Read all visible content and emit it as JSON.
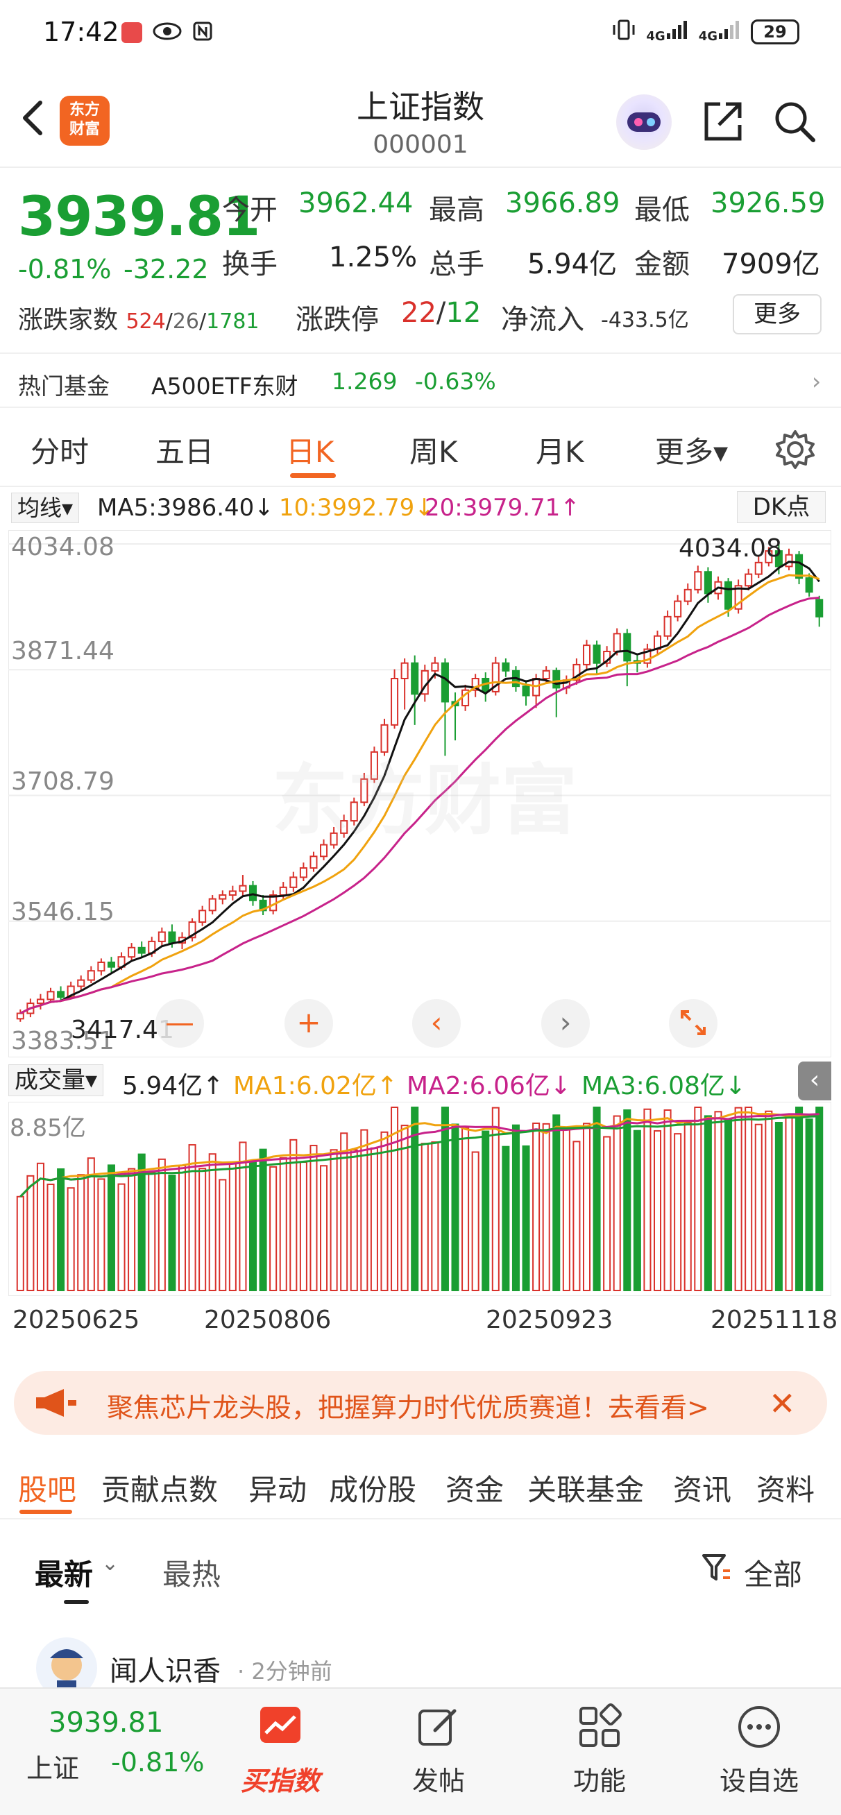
{
  "status": {
    "time": "17:42",
    "battery": "29",
    "net1": "4G",
    "net2": "4G"
  },
  "header": {
    "title": "上证指数",
    "code": "000001",
    "logo_line1": "东方",
    "logo_line2": "财富"
  },
  "quote": {
    "price": "3939.81",
    "pct": "-0.81%",
    "change": "-32.22",
    "open_label": "今开",
    "open": "3962.44",
    "high_label": "最高",
    "high": "3966.89",
    "low_label": "最低",
    "low": "3926.59",
    "turnover_label": "换手",
    "turnover": "1.25%",
    "volume_label": "总手",
    "volume": "5.94亿",
    "amount_label": "金额",
    "amount": "7909亿",
    "breadth_label": "涨跌家数",
    "breadth_up": "524",
    "breadth_flat": "26",
    "breadth_down": "1781",
    "limit_label": "涨跌停",
    "limit_up": "22",
    "limit_down": "12",
    "inflow_label": "净流入",
    "inflow": "-433.5亿",
    "more": "更多"
  },
  "hotfund": {
    "label": "热门基金",
    "name": "A500ETF东财",
    "price": "1.269",
    "pct": "-0.63%"
  },
  "tabs": [
    "分时",
    "五日",
    "日K",
    "周K",
    "月K",
    "更多▾"
  ],
  "ma": {
    "selector": "均线▾",
    "ma5": "MA5:3986.40↓",
    "ma10": "10:3992.79↓",
    "ma20": "20:3979.71↑",
    "dk": "DK点"
  },
  "kchart": {
    "y_labels": [
      "4034.08",
      "3871.44",
      "3708.79",
      "3546.15",
      "3383.51"
    ],
    "high_mark": "4034.08",
    "low_mark": "3417.41",
    "watermark": "东方财富"
  },
  "controls": {
    "minus": "—",
    "plus": "+",
    "prev": "‹",
    "next": "›"
  },
  "volume": {
    "selector": "成交量▾",
    "value": "5.94亿↑",
    "ma1": "MA1:6.02亿↑",
    "ma2": "MA2:6.06亿↓",
    "ma3": "MA3:6.08亿↓",
    "max_label": "8.85亿"
  },
  "dates": [
    "20250625",
    "20250806",
    "20250923",
    "20251118"
  ],
  "banner": {
    "text": "聚焦芯片龙头股，把握算力时代优质赛道！去看看>"
  },
  "subtabs": [
    "股吧",
    "贡献点数",
    "异动",
    "成份股",
    "资金",
    "关联基金",
    "资讯",
    "资料"
  ],
  "sort": {
    "latest": "最新",
    "hot": "最热",
    "all": "全部"
  },
  "post": {
    "name": "闻人识香",
    "time": "· 2分钟前"
  },
  "bottombar": {
    "price": "3939.81",
    "name": "上证",
    "pct": "-0.81%",
    "buy": "买指数",
    "post": "发帖",
    "func": "功能",
    "watch": "设自选"
  },
  "colors": {
    "up": "#d9312b",
    "down": "#1a9e33",
    "accent": "#f26522",
    "ma5": "#111111",
    "ma10": "#f0a20e",
    "ma20": "#c7228a"
  },
  "chart_data": {
    "type": "candlestick",
    "y_range": [
      3383.51,
      4034.08
    ],
    "date_ticks": [
      "20250625",
      "20250806",
      "20250923",
      "20251118"
    ],
    "candles": [
      [
        3420,
        3427,
        3416,
        3432
      ],
      [
        3427,
        3440,
        3422,
        3446
      ],
      [
        3440,
        3445,
        3432,
        3452
      ],
      [
        3445,
        3455,
        3440,
        3460
      ],
      [
        3455,
        3448,
        3442,
        3462
      ],
      [
        3448,
        3462,
        3445,
        3468
      ],
      [
        3462,
        3470,
        3456,
        3476
      ],
      [
        3470,
        3482,
        3466,
        3488
      ],
      [
        3482,
        3493,
        3476,
        3498
      ],
      [
        3493,
        3487,
        3480,
        3500
      ],
      [
        3487,
        3500,
        3483,
        3506
      ],
      [
        3500,
        3512,
        3495,
        3518
      ],
      [
        3512,
        3505,
        3498,
        3520
      ],
      [
        3505,
        3520,
        3500,
        3526
      ],
      [
        3520,
        3532,
        3515,
        3538
      ],
      [
        3532,
        3518,
        3512,
        3542
      ],
      [
        3518,
        3525,
        3510,
        3532
      ],
      [
        3525,
        3545,
        3520,
        3550
      ],
      [
        3545,
        3560,
        3540,
        3566
      ],
      [
        3560,
        3575,
        3555,
        3580
      ],
      [
        3575,
        3580,
        3568,
        3586
      ],
      [
        3580,
        3585,
        3573,
        3592
      ],
      [
        3585,
        3592,
        3578,
        3606
      ],
      [
        3592,
        3573,
        3566,
        3598
      ],
      [
        3573,
        3560,
        3554,
        3580
      ],
      [
        3560,
        3580,
        3555,
        3586
      ],
      [
        3580,
        3590,
        3575,
        3597
      ],
      [
        3590,
        3603,
        3584,
        3610
      ],
      [
        3603,
        3615,
        3598,
        3622
      ],
      [
        3615,
        3630,
        3610,
        3636
      ],
      [
        3630,
        3645,
        3625,
        3652
      ],
      [
        3645,
        3660,
        3640,
        3668
      ],
      [
        3660,
        3676,
        3654,
        3684
      ],
      [
        3676,
        3700,
        3670,
        3706
      ],
      [
        3700,
        3730,
        3695,
        3738
      ],
      [
        3730,
        3765,
        3725,
        3772
      ],
      [
        3765,
        3800,
        3760,
        3808
      ],
      [
        3800,
        3860,
        3795,
        3872
      ],
      [
        3860,
        3880,
        3820,
        3886
      ],
      [
        3880,
        3840,
        3800,
        3890
      ],
      [
        3840,
        3870,
        3830,
        3878
      ],
      [
        3870,
        3880,
        3860,
        3888
      ],
      [
        3880,
        3830,
        3760,
        3886
      ],
      [
        3830,
        3825,
        3780,
        3842
      ],
      [
        3825,
        3845,
        3818,
        3852
      ],
      [
        3845,
        3860,
        3836,
        3866
      ],
      [
        3860,
        3843,
        3830,
        3868
      ],
      [
        3843,
        3880,
        3838,
        3888
      ],
      [
        3880,
        3870,
        3862,
        3886
      ],
      [
        3870,
        3850,
        3843,
        3876
      ],
      [
        3850,
        3838,
        3825,
        3858
      ],
      [
        3838,
        3860,
        3822,
        3866
      ],
      [
        3860,
        3870,
        3855,
        3876
      ],
      [
        3870,
        3848,
        3810,
        3874
      ],
      [
        3848,
        3858,
        3840,
        3864
      ],
      [
        3858,
        3878,
        3852,
        3886
      ],
      [
        3878,
        3903,
        3872,
        3910
      ],
      [
        3903,
        3880,
        3866,
        3909
      ],
      [
        3880,
        3895,
        3875,
        3902
      ],
      [
        3895,
        3918,
        3890,
        3925
      ],
      [
        3918,
        3883,
        3850,
        3924
      ],
      [
        3883,
        3880,
        3868,
        3890
      ],
      [
        3880,
        3898,
        3874,
        3905
      ],
      [
        3898,
        3915,
        3892,
        3922
      ],
      [
        3915,
        3940,
        3910,
        3948
      ],
      [
        3940,
        3960,
        3934,
        3968
      ],
      [
        3960,
        3975,
        3955,
        3983
      ],
      [
        3975,
        3998,
        3970,
        4006
      ],
      [
        3998,
        3970,
        3958,
        4004
      ],
      [
        3970,
        3985,
        3962,
        3992
      ],
      [
        3985,
        3950,
        3940,
        3990
      ],
      [
        3950,
        3980,
        3944,
        3988
      ],
      [
        3980,
        3995,
        3974,
        4002
      ],
      [
        3995,
        4010,
        3990,
        4018
      ],
      [
        4010,
        4025,
        4005,
        4030
      ],
      [
        4025,
        4005,
        3995,
        4034
      ],
      [
        4005,
        4020,
        4000,
        4028
      ],
      [
        4020,
        3990,
        3982,
        4025
      ],
      [
        3990,
        3972,
        3966,
        3996
      ],
      [
        3962,
        3940,
        3927,
        3967
      ]
    ],
    "volume_max": "8.85亿",
    "series": [
      {
        "name": "MA5",
        "last": "3986.40"
      },
      {
        "name": "MA10",
        "last": "3992.79"
      },
      {
        "name": "MA20",
        "last": "3979.71"
      }
    ]
  }
}
